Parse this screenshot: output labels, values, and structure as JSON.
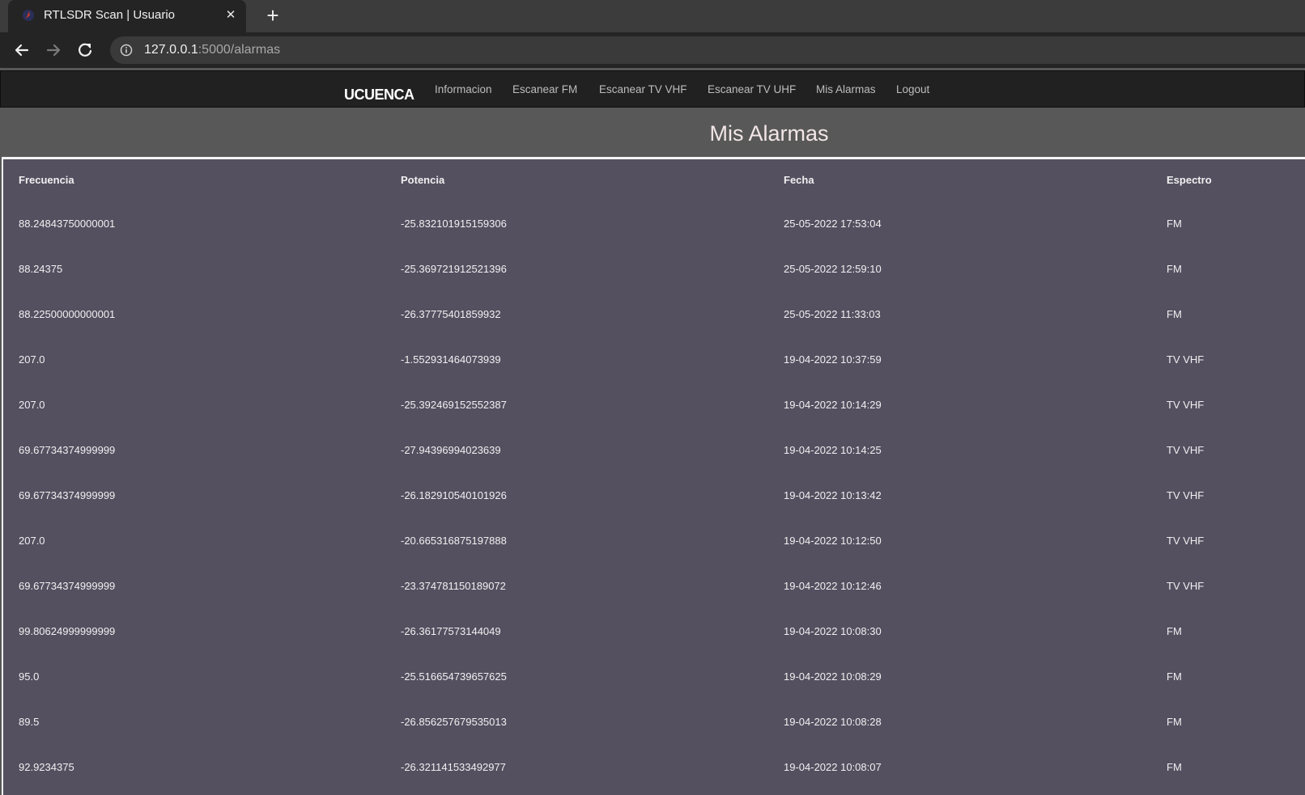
{
  "browser": {
    "tab_title": "RTLSDR Scan | Usuario",
    "url_host": "127.0.0.1",
    "url_path": ":5000/alarmas"
  },
  "navbar": {
    "brand": "UCUENCA",
    "links": [
      "Informacion",
      "Escanear FM",
      "Escanear TV VHF",
      "Escanear TV UHF",
      "Mis Alarmas",
      "Logout"
    ]
  },
  "page": {
    "title": "Mis Alarmas"
  },
  "table": {
    "headers": [
      "Frecuencia",
      "Potencia",
      "Fecha",
      "Espectro"
    ],
    "rows": [
      [
        "88.24843750000001",
        "-25.832101915159306",
        "25-05-2022 17:53:04",
        "FM"
      ],
      [
        "88.24375",
        "-25.369721912521396",
        "25-05-2022 12:59:10",
        "FM"
      ],
      [
        "88.22500000000001",
        "-26.37775401859932",
        "25-05-2022 11:33:03",
        "FM"
      ],
      [
        "207.0",
        "-1.552931464073939",
        "19-04-2022 10:37:59",
        "TV VHF"
      ],
      [
        "207.0",
        "-25.392469152552387",
        "19-04-2022 10:14:29",
        "TV VHF"
      ],
      [
        "69.67734374999999",
        "-27.94396994023639",
        "19-04-2022 10:14:25",
        "TV VHF"
      ],
      [
        "69.67734374999999",
        "-26.182910540101926",
        "19-04-2022 10:13:42",
        "TV VHF"
      ],
      [
        "207.0",
        "-20.665316875197888",
        "19-04-2022 10:12:50",
        "TV VHF"
      ],
      [
        "69.67734374999999",
        "-23.374781150189072",
        "19-04-2022 10:12:46",
        "TV VHF"
      ],
      [
        "99.80624999999999",
        "-26.36177573144049",
        "19-04-2022 10:08:30",
        "FM"
      ],
      [
        "95.0",
        "-25.516654739657625",
        "19-04-2022 10:08:29",
        "FM"
      ],
      [
        "89.5",
        "-26.856257679535013",
        "19-04-2022 10:08:28",
        "FM"
      ],
      [
        "92.9234375",
        "-26.321141533492977",
        "19-04-2022 10:08:07",
        "FM"
      ]
    ]
  }
}
